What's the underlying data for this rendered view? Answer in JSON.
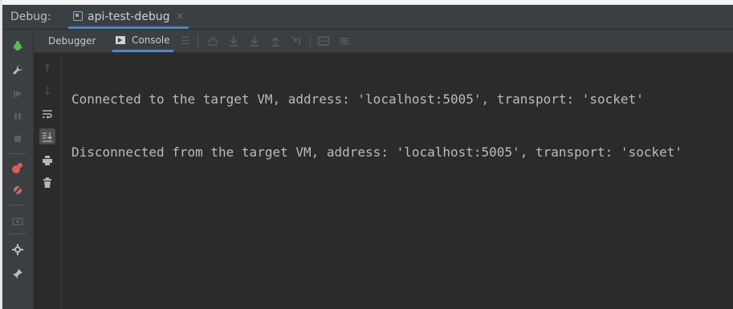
{
  "header": {
    "debug_label": "Debug:",
    "session_tab": "api-test-debug",
    "close_glyph": "×"
  },
  "subtoolbar": {
    "debugger_label": "Debugger",
    "console_label": "Console"
  },
  "icons": {
    "bug": "bug-icon",
    "wrench": "wrench-icon",
    "resume": "resume-icon",
    "pause": "pause-icon",
    "stop": "stop-icon",
    "breakpoints": "view-breakpoints-icon",
    "mute": "mute-breakpoints-icon",
    "camera": "snapshot-icon",
    "settings": "settings-icon",
    "pin": "pin-icon"
  },
  "console": {
    "lines": [
      "Connected to the target VM, address: 'localhost:5005', transport: 'socket'",
      "Disconnected from the target VM, address: 'localhost:5005', transport: 'socket'"
    ]
  },
  "colors": {
    "background": "#2b2b2b",
    "toolbar": "#3c3f41",
    "accent": "#4a88c7",
    "text": "#bbbbbb"
  }
}
